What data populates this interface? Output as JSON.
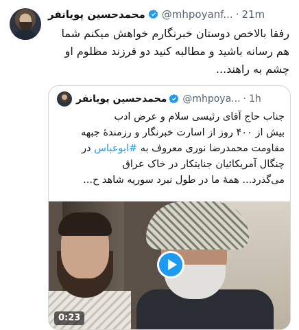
{
  "tweet": {
    "author_name": "محمدحسین پویانفر",
    "handle": "@mhpoyanf...",
    "separator": "·",
    "time": "21m",
    "text_lines": [
      "رفقا بالاخص دوستان خبرنگارم خواهش میکنم شما",
      "هم رسانه باشید و مطالبه کنید دو فرزند مظلوم او",
      "چشم به راهند..."
    ]
  },
  "quoted_tweet": {
    "author_name": "محمدحسین پویانفر",
    "handle": "@mhpoya...",
    "separator": "·",
    "time": "1h",
    "text_lines": [
      "جناب حاج آقای رئیسی سلام و عرض ادب",
      "بیش از ۴۰۰ روز از اسارت خبرنگار و رزمندهٔ جبهه",
      "مقاومت محمدرضا نوری معروف به",
      "چنگال آمریکائیان جنایتکار در خاک عراق",
      "می‌گذرد... همهٔ ما در طول نبرد سوریه شاهد ح..."
    ],
    "hashtag": "#ابوعباس",
    "hashtag_suffix": " در",
    "video": {
      "duration": "0:23",
      "play_icon": "play-icon"
    }
  },
  "colors": {
    "accent": "#1d9bf0",
    "secondary_text": "#536471",
    "border": "#cfd9de"
  }
}
